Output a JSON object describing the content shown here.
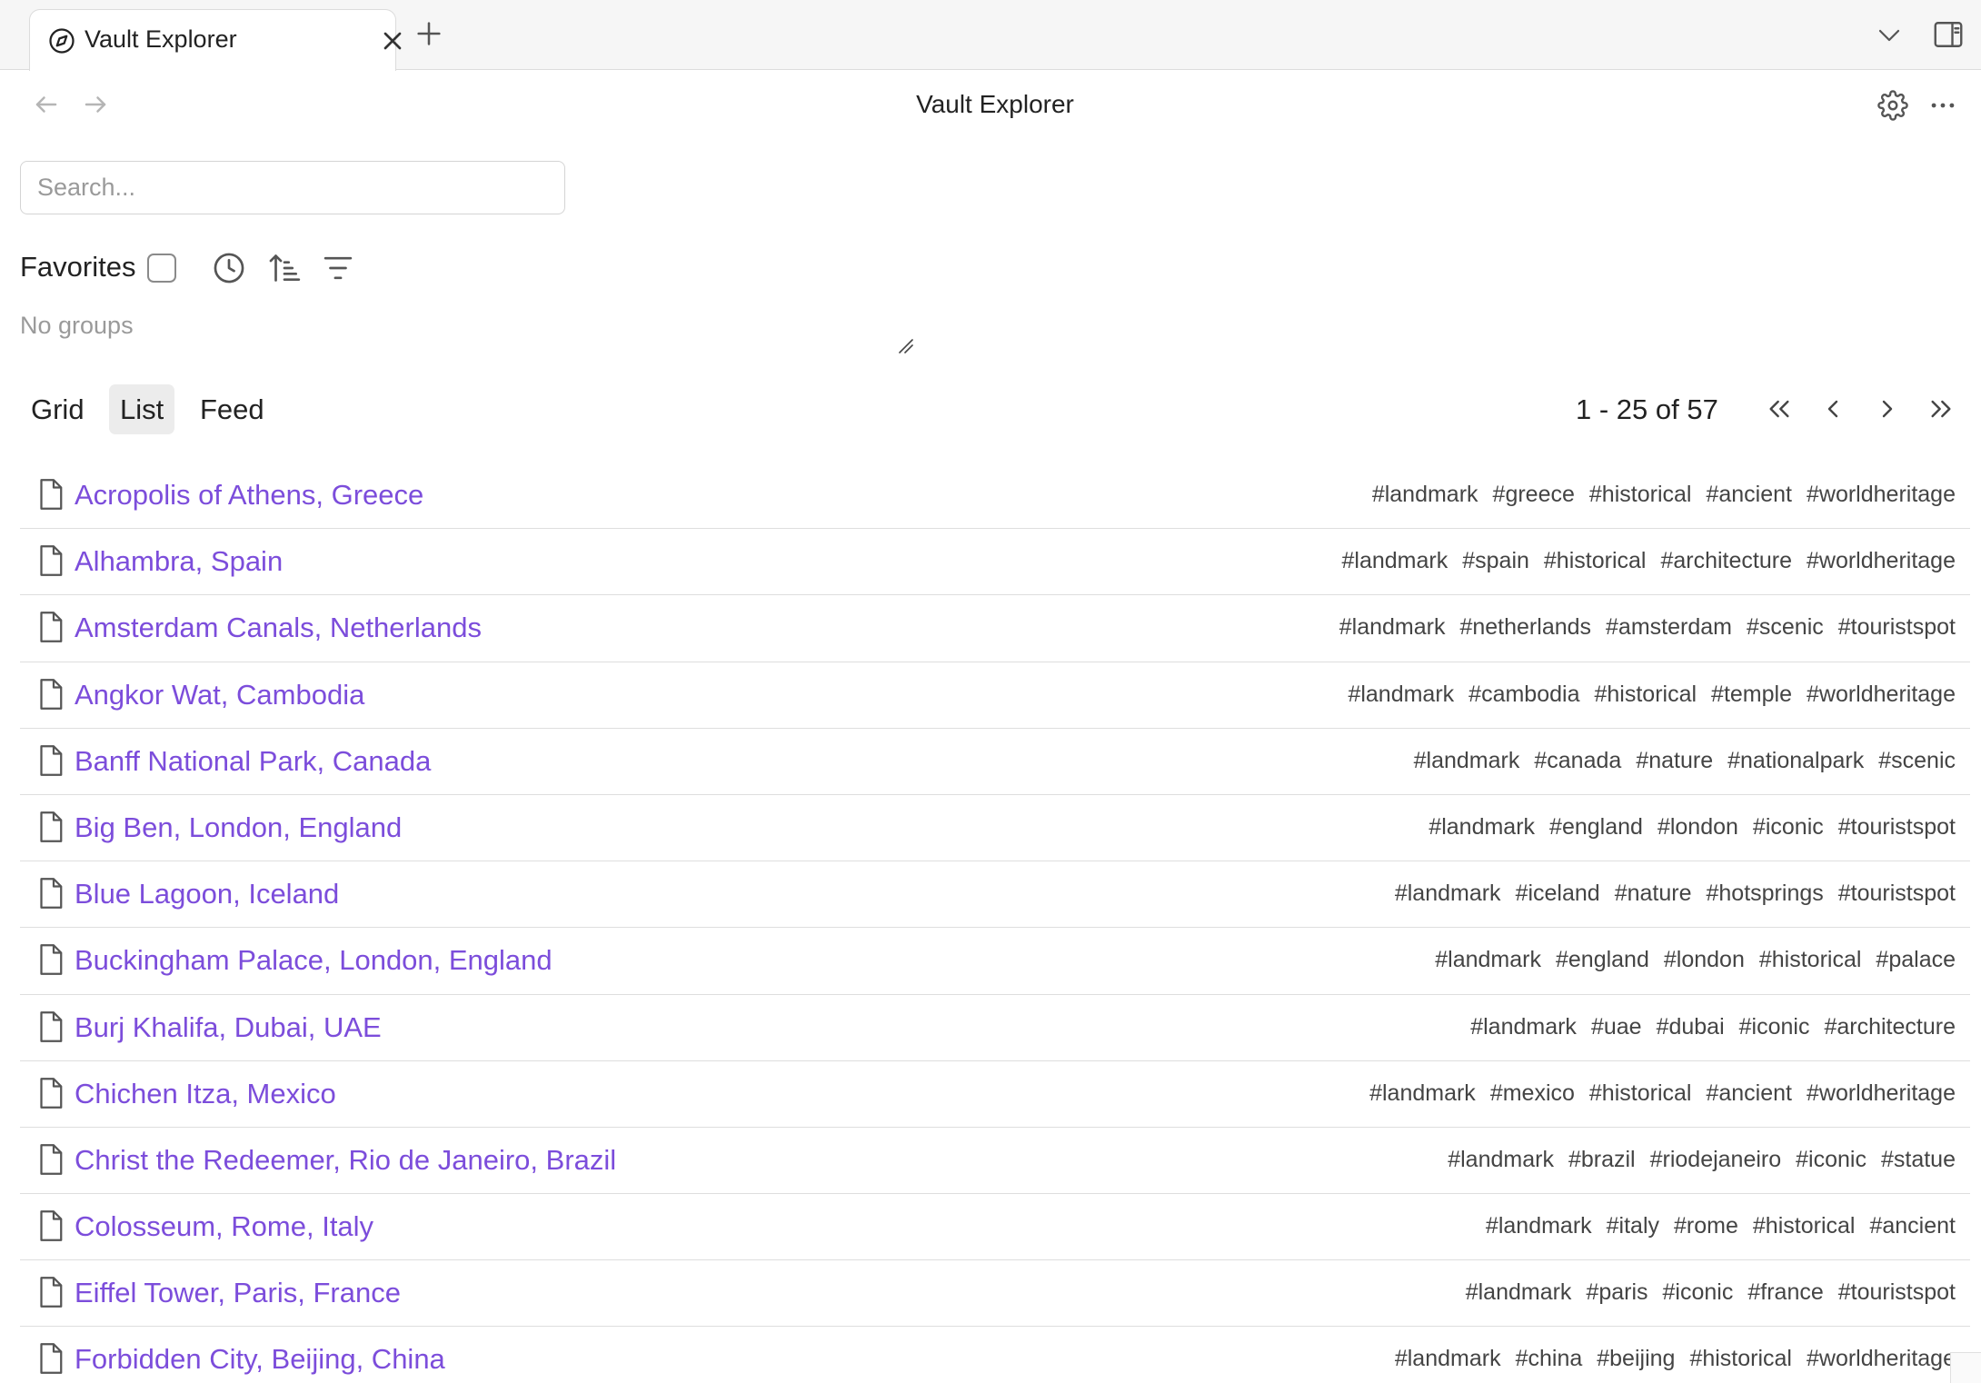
{
  "tab": {
    "title": "Vault Explorer"
  },
  "header": {
    "title": "Vault Explorer"
  },
  "search": {
    "placeholder": "Search...",
    "value": ""
  },
  "filters": {
    "favorites_label": "Favorites",
    "favorites_checked": false,
    "no_groups_text": "No groups"
  },
  "views": {
    "grid": "Grid",
    "list": "List",
    "feed": "Feed",
    "active": "List"
  },
  "pagination": {
    "text": "1 - 25 of 57"
  },
  "colors": {
    "link": "#7c4ddb",
    "tag": "#444444",
    "active_view_bg": "#ececec"
  },
  "icons": {
    "tab": "compass-icon",
    "close": "close-icon",
    "new_tab": "plus-icon",
    "tab_list": "chevron-down-icon",
    "sidebar": "sidebar-toggle-icon",
    "back": "arrow-left-icon",
    "forward": "arrow-right-icon",
    "settings": "gear-icon",
    "more": "more-horizontal-icon",
    "timestamp": "clock-icon",
    "sort": "sort-ascending-icon",
    "filter": "filter-icon",
    "file": "file-icon"
  },
  "notes": [
    {
      "title": "Acropolis of Athens, Greece",
      "tags": [
        "#landmark",
        "#greece",
        "#historical",
        "#ancient",
        "#worldheritage"
      ]
    },
    {
      "title": "Alhambra, Spain",
      "tags": [
        "#landmark",
        "#spain",
        "#historical",
        "#architecture",
        "#worldheritage"
      ]
    },
    {
      "title": "Amsterdam Canals, Netherlands",
      "tags": [
        "#landmark",
        "#netherlands",
        "#amsterdam",
        "#scenic",
        "#touristspot"
      ]
    },
    {
      "title": "Angkor Wat, Cambodia",
      "tags": [
        "#landmark",
        "#cambodia",
        "#historical",
        "#temple",
        "#worldheritage"
      ]
    },
    {
      "title": "Banff National Park, Canada",
      "tags": [
        "#landmark",
        "#canada",
        "#nature",
        "#nationalpark",
        "#scenic"
      ]
    },
    {
      "title": "Big Ben, London, England",
      "tags": [
        "#landmark",
        "#england",
        "#london",
        "#iconic",
        "#touristspot"
      ]
    },
    {
      "title": "Blue Lagoon, Iceland",
      "tags": [
        "#landmark",
        "#iceland",
        "#nature",
        "#hotsprings",
        "#touristspot"
      ]
    },
    {
      "title": "Buckingham Palace, London, England",
      "tags": [
        "#landmark",
        "#england",
        "#london",
        "#historical",
        "#palace"
      ]
    },
    {
      "title": "Burj Khalifa, Dubai, UAE",
      "tags": [
        "#landmark",
        "#uae",
        "#dubai",
        "#iconic",
        "#architecture"
      ]
    },
    {
      "title": "Chichen Itza, Mexico",
      "tags": [
        "#landmark",
        "#mexico",
        "#historical",
        "#ancient",
        "#worldheritage"
      ]
    },
    {
      "title": "Christ the Redeemer, Rio de Janeiro, Brazil",
      "tags": [
        "#landmark",
        "#brazil",
        "#riodejaneiro",
        "#iconic",
        "#statue"
      ]
    },
    {
      "title": "Colosseum, Rome, Italy",
      "tags": [
        "#landmark",
        "#italy",
        "#rome",
        "#historical",
        "#ancient"
      ]
    },
    {
      "title": "Eiffel Tower, Paris, France",
      "tags": [
        "#landmark",
        "#paris",
        "#iconic",
        "#france",
        "#touristspot"
      ]
    },
    {
      "title": "Forbidden City, Beijing, China",
      "tags": [
        "#landmark",
        "#china",
        "#beijing",
        "#historical",
        "#worldheritage"
      ]
    }
  ]
}
